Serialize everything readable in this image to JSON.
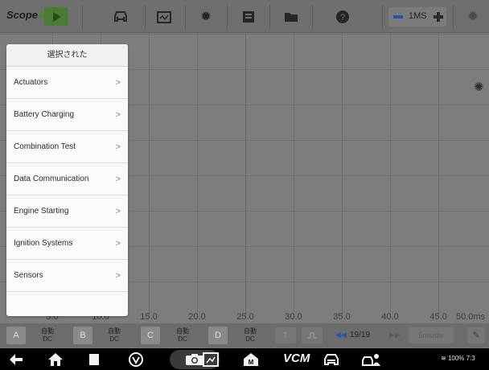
{
  "toolbar": {
    "logo": "Scope",
    "timebase_value": "1MS",
    "icons": [
      "play-icon",
      "car-icon",
      "calendar-icon",
      "gear-icon",
      "list-icon",
      "folder-icon",
      "help-icon",
      "settings-icon"
    ]
  },
  "menu": {
    "header": "選択された",
    "items": [
      {
        "label": "Actuators"
      },
      {
        "label": "Battery Charging"
      },
      {
        "label": "Combination Test"
      },
      {
        "label": "Data Communication"
      },
      {
        "label": "Engine Starting"
      },
      {
        "label": "Ignition Systems"
      },
      {
        "label": "Sensors"
      }
    ]
  },
  "plot": {
    "x_ticks": [
      "5.0",
      "10.0",
      "15.0",
      "20.0",
      "25.0",
      "30.0",
      "35.0",
      "40.0",
      "45.0",
      "50.0ms"
    ]
  },
  "channels": [
    {
      "letter": "A",
      "mode_line1": "自動",
      "mode_line2": "DC"
    },
    {
      "letter": "B",
      "mode_line1": "自動",
      "mode_line2": "DC"
    },
    {
      "letter": "C",
      "mode_line1": "自動",
      "mode_line2": "DC"
    },
    {
      "letter": "D",
      "mode_line1": "自動",
      "mode_line2": "DC"
    }
  ],
  "bottom": {
    "trigger_label": "T",
    "page_counter": "19/19",
    "time_div": "5ms/div"
  },
  "navbar": {
    "vcm_label": "VCM",
    "status_text": "100% 7:3"
  },
  "colors": {
    "accent_green": "#4b7a33",
    "accent_blue": "#2157ad",
    "plot_bg": "#7d7d7d"
  }
}
